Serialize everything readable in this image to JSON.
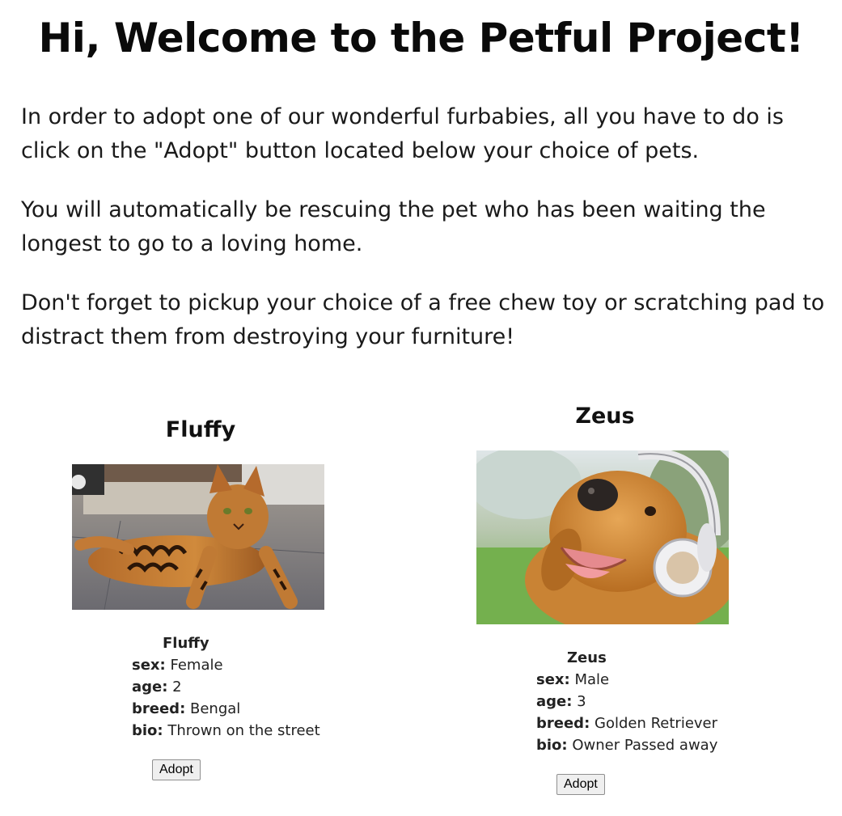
{
  "header": {
    "title": "Hi, Welcome to the Petful Project!"
  },
  "intro": {
    "paragraph1": "In order to adopt one of our wonderful furbabies, all you have to do is click on the \"Adopt\" button located below your choice of pets.",
    "paragraph2": "You will automatically be rescuing the pet who has been waiting the longest to go to a loving home.",
    "paragraph3": "Don't forget to pickup your choice of a free chew toy or scratching pad to distract them from destroying your furniture!"
  },
  "pets": [
    {
      "heading": "Fluffy",
      "name": "Fluffy",
      "sex_label": "sex:",
      "sex": "Female",
      "age_label": "age:",
      "age": "2",
      "breed_label": "breed:",
      "breed": "Bengal",
      "bio_label": "bio:",
      "bio": "Thrown on the street",
      "adopt_label": "Adopt",
      "photo_icon": "bengal-cat-photo"
    },
    {
      "heading": "Zeus",
      "name": "Zeus",
      "sex_label": "sex:",
      "sex": "Male",
      "age_label": "age:",
      "age": "3",
      "breed_label": "breed:",
      "breed": "Golden Retriever",
      "bio_label": "bio:",
      "bio": "Owner Passed away",
      "adopt_label": "Adopt",
      "photo_icon": "golden-retriever-photo"
    }
  ]
}
